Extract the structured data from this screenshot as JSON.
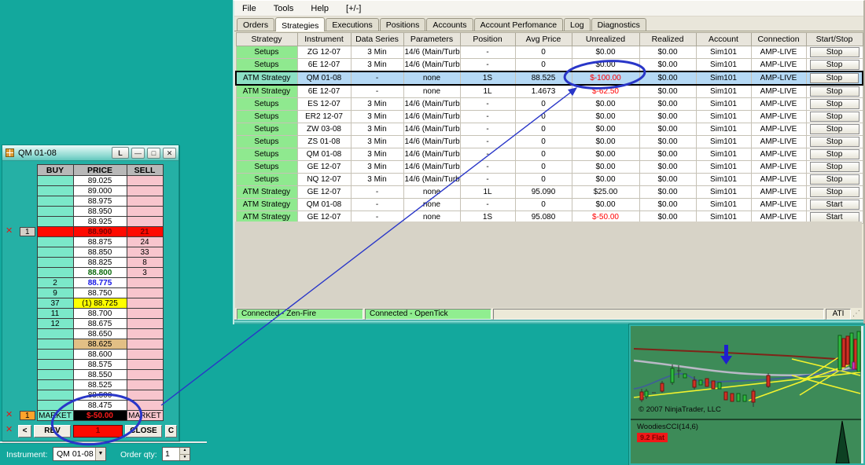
{
  "control_center": {
    "menu": [
      "File",
      "Tools",
      "Help",
      "[+/-]"
    ],
    "tabs": [
      "Orders",
      "Strategies",
      "Executions",
      "Positions",
      "Accounts",
      "Account Perfomance",
      "Log",
      "Diagnostics"
    ],
    "active_tab": "Strategies",
    "grid": {
      "columns": [
        "Strategy",
        "Instrument",
        "Data Series",
        "Parameters",
        "Position",
        "Avg Price",
        "Unrealized",
        "Realized",
        "Account",
        "Connection",
        "Start/Stop"
      ],
      "rows": [
        {
          "strategy": "Setups",
          "instrument": "ZG 12-07",
          "data_series": "3 Min",
          "parameters": "14/6 (Main/Turb",
          "position": "-",
          "avg_price": "0",
          "unrealized": "$0.00",
          "realized": "$0.00",
          "account": "Sim101",
          "connection": "AMP-LIVE",
          "action": "Stop"
        },
        {
          "strategy": "Setups",
          "instrument": "6E 12-07",
          "data_series": "3 Min",
          "parameters": "14/6 (Main/Turb",
          "position": "-",
          "avg_price": "0",
          "unrealized": "$0.00",
          "realized": "$0.00",
          "account": "Sim101",
          "connection": "AMP-LIVE",
          "action": "Stop"
        },
        {
          "strategy": "ATM Strategy",
          "instrument": "QM 01-08",
          "data_series": "-",
          "parameters": "none",
          "position": "1S",
          "avg_price": "88.525",
          "unrealized": "$-100.00",
          "realized": "$0.00",
          "account": "Sim101",
          "connection": "AMP-LIVE",
          "action": "Stop",
          "rowClass": "selected",
          "uClass": "neg"
        },
        {
          "strategy": "ATM Strategy",
          "instrument": "6E 12-07",
          "data_series": "-",
          "parameters": "none",
          "position": "1L",
          "avg_price": "1.4673",
          "unrealized": "$-62.50",
          "realized": "$0.00",
          "account": "Sim101",
          "connection": "AMP-LIVE",
          "action": "Stop",
          "uClass": "neg"
        },
        {
          "strategy": "Setups",
          "instrument": "ES 12-07",
          "data_series": "3 Min",
          "parameters": "14/6 (Main/Turb",
          "position": "-",
          "avg_price": "0",
          "unrealized": "$0.00",
          "realized": "$0.00",
          "account": "Sim101",
          "connection": "AMP-LIVE",
          "action": "Stop"
        },
        {
          "strategy": "Setups",
          "instrument": "ER2 12-07",
          "data_series": "3 Min",
          "parameters": "14/6 (Main/Turb",
          "position": "-",
          "avg_price": "0",
          "unrealized": "$0.00",
          "realized": "$0.00",
          "account": "Sim101",
          "connection": "AMP-LIVE",
          "action": "Stop"
        },
        {
          "strategy": "Setups",
          "instrument": "ZW 03-08",
          "data_series": "3 Min",
          "parameters": "14/6 (Main/Turb",
          "position": "-",
          "avg_price": "0",
          "unrealized": "$0.00",
          "realized": "$0.00",
          "account": "Sim101",
          "connection": "AMP-LIVE",
          "action": "Stop"
        },
        {
          "strategy": "Setups",
          "instrument": "ZS 01-08",
          "data_series": "3 Min",
          "parameters": "14/6 (Main/Turb",
          "position": "-",
          "avg_price": "0",
          "unrealized": "$0.00",
          "realized": "$0.00",
          "account": "Sim101",
          "connection": "AMP-LIVE",
          "action": "Stop"
        },
        {
          "strategy": "Setups",
          "instrument": "QM 01-08",
          "data_series": "3 Min",
          "parameters": "14/6 (Main/Turb",
          "position": "-",
          "avg_price": "0",
          "unrealized": "$0.00",
          "realized": "$0.00",
          "account": "Sim101",
          "connection": "AMP-LIVE",
          "action": "Stop"
        },
        {
          "strategy": "Setups",
          "instrument": "GE 12-07",
          "data_series": "3 Min",
          "parameters": "14/6 (Main/Turb",
          "position": "-",
          "avg_price": "0",
          "unrealized": "$0.00",
          "realized": "$0.00",
          "account": "Sim101",
          "connection": "AMP-LIVE",
          "action": "Stop"
        },
        {
          "strategy": "Setups",
          "instrument": "NQ 12-07",
          "data_series": "3 Min",
          "parameters": "14/6 (Main/Turb",
          "position": "-",
          "avg_price": "0",
          "unrealized": "$0.00",
          "realized": "$0.00",
          "account": "Sim101",
          "connection": "AMP-LIVE",
          "action": "Stop"
        },
        {
          "strategy": "ATM Strategy",
          "instrument": "GE 12-07",
          "data_series": "-",
          "parameters": "none",
          "position": "1L",
          "avg_price": "95.090",
          "unrealized": "$25.00",
          "realized": "$0.00",
          "account": "Sim101",
          "connection": "AMP-LIVE",
          "action": "Stop"
        },
        {
          "strategy": "ATM Strategy",
          "instrument": "QM 01-08",
          "data_series": "-",
          "parameters": "none",
          "position": "-",
          "avg_price": "0",
          "unrealized": "$0.00",
          "realized": "$0.00",
          "account": "Sim101",
          "connection": "AMP-LIVE",
          "action": "Start"
        },
        {
          "strategy": "ATM Strategy",
          "instrument": "GE 12-07",
          "data_series": "-",
          "parameters": "none",
          "position": "1S",
          "avg_price": "95.080",
          "unrealized": "$-50.00",
          "realized": "$0.00",
          "account": "Sim101",
          "connection": "AMP-LIVE",
          "action": "Start",
          "uClass": "neg"
        }
      ]
    },
    "status": {
      "badges": [
        "Connected - Zen-Fire",
        "Connected - OpenTick"
      ],
      "ati": "ATI",
      "grip": "⋰"
    }
  },
  "dom": {
    "title": "QM 01-08",
    "l_button": "L",
    "x_mark": "✕",
    "columns": [
      "BUY",
      "PRICE",
      "SELL"
    ],
    "rows": [
      {
        "price": "89.025"
      },
      {
        "price": "89.000"
      },
      {
        "price": "88.975"
      },
      {
        "price": "88.950"
      },
      {
        "price": "88.925"
      },
      {
        "qty": "1",
        "price": "88.900",
        "sell": "21",
        "rowClass": "hit"
      },
      {
        "price": "88.875",
        "sell": "24"
      },
      {
        "price": "88.850",
        "sell": "33"
      },
      {
        "price": "88.825",
        "sell": "8"
      },
      {
        "price": "88.800",
        "sell": "3",
        "priceClass": "pgreen"
      },
      {
        "buy": "2",
        "price": "88.775",
        "priceClass": "pblue"
      },
      {
        "buy": "9",
        "price": "88.750"
      },
      {
        "buy": "37",
        "price": "(1) 88.725",
        "priceClass": "pyellow"
      },
      {
        "buy": "11",
        "price": "88.700"
      },
      {
        "buy": "12",
        "price": "88.675"
      },
      {
        "price": "88.650"
      },
      {
        "price": "88.625",
        "priceClass": "ptan"
      },
      {
        "price": "88.600"
      },
      {
        "price": "88.575"
      },
      {
        "price": "88.550"
      },
      {
        "price": "88.525"
      },
      {
        "price": "88.500"
      },
      {
        "price": "88.475"
      }
    ],
    "market_row": {
      "qty": "1",
      "buy": "MARKET",
      "price": "$-50.00",
      "sell": "MARKET"
    },
    "buttons": {
      "back": "<",
      "rev": "REV",
      "qty": "1",
      "close": "CLOSE",
      "c": "C"
    }
  },
  "instrument_bar": {
    "instrument_label": "Instrument:",
    "instrument_value": "QM 01-08",
    "qty_label": "Order qty:",
    "qty_value": "1"
  },
  "chart": {
    "copyright": "© 2007 NinjaTrader, LLC",
    "indicator": "WoodiesCCI(14,6)",
    "badge": "9.2 Flat"
  },
  "icons": {
    "dropdown_arrow": "▼",
    "spin_up": "▲",
    "spin_down": "▼",
    "minimize": "—",
    "maximize": "□",
    "close": "✕"
  },
  "colors": {
    "desktop": "#13a89d",
    "annotation_blue": "#2936c8",
    "strategy_green": "#8fe98f",
    "selected_row_blue": "#b5d9f5",
    "negative_red": "#ff0000",
    "dom_buy": "#7be8c9",
    "dom_sell": "#f8c5cd",
    "hit_red": "#fe0a00"
  }
}
